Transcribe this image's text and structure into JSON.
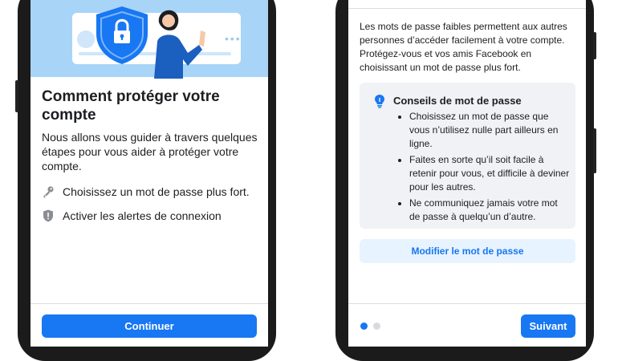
{
  "colors": {
    "accent": "#1877f2",
    "hero_bg": "#a8d4f8",
    "shield": "#1877f2",
    "dot_active": "#1877f2",
    "dot_inactive": "#d8dadf"
  },
  "screen1": {
    "title": "Comment protéger votre compte",
    "description": "Nous allons vous guider à travers quelques étapes pour vous aider à protéger votre compte.",
    "options": [
      {
        "icon": "key-icon",
        "label": "Choisissez un mot de passe plus fort."
      },
      {
        "icon": "shield-alert-icon",
        "label": "Activer les alertes de connexion"
      }
    ],
    "continue_label": "Continuer"
  },
  "screen2": {
    "description": "Les mots de passe faibles permettent aux autres personnes d’accéder facilement à votre compte. Protégez-vous et vos amis Facebook en choisissant un mot de passe plus fort.",
    "tips_icon": "lightbulb-icon",
    "tips_title": "Conseils de mot de passe",
    "tips": [
      "Choisissez un mot de passe que vous n’utilisez nulle part ailleurs en ligne.",
      "Faites en sorte qu’il soit facile à retenir pour vous, et difficile à deviner pour les autres.",
      "Ne communiquez jamais votre mot de passe à quelqu’un d’autre."
    ],
    "change_password_label": "Modifier le mot de passe",
    "pagination": {
      "current": 1,
      "total": 2
    },
    "next_label": "Suivant"
  }
}
